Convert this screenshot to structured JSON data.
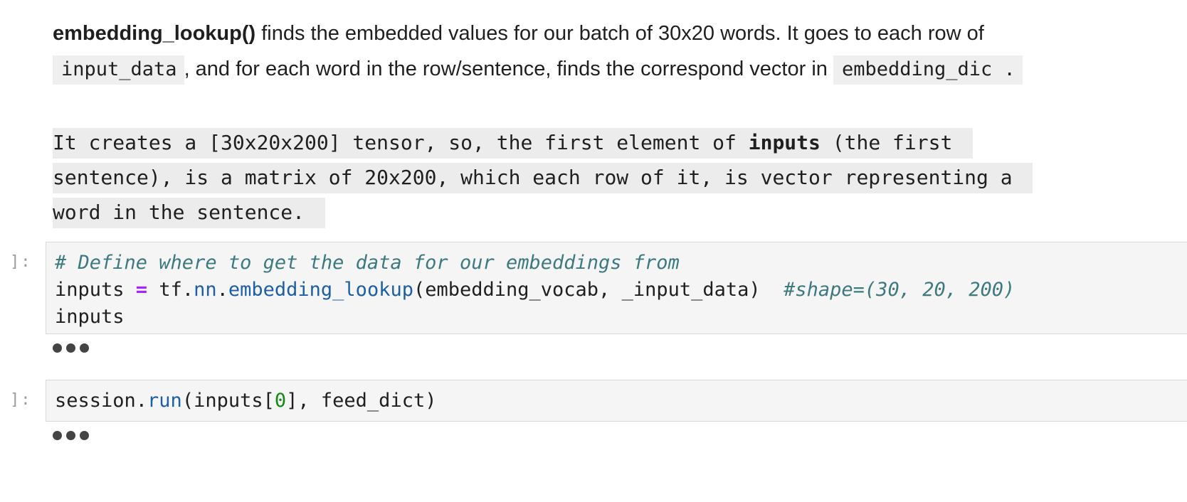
{
  "markdown": {
    "para1": {
      "bold_term": "embedding_lookup()",
      "text_a": " finds the embedded values for our batch of 30x20 words. It goes to each row of",
      "code_input": "input_data",
      "text_b": ", and for each word in the row/sentence, finds the correspond vector in ",
      "code_dic": "embedding_dic ."
    },
    "para2": {
      "line1_a": "It creates a [30x20x200] tensor, so, the first element of ",
      "line1_bold": "inputs",
      "line1_b": " (the first ",
      "line2": "sentence), is a matrix of 20x200, which each row of it, is vector representing a ",
      "line3": "word in the sentence. "
    }
  },
  "cells": [
    {
      "prompt": "]:",
      "comment": "# Define where to get the data for our embeddings from",
      "line2": {
        "var": "inputs ",
        "op": "=",
        "mod": " tf.",
        "attr1": "nn",
        "dot": ".",
        "attr2": "embedding_lookup",
        "args": "(embedding_vocab, _input_data)  ",
        "comment": "#shape=(30, 20, 200)"
      },
      "line3": "inputs"
    },
    {
      "prompt": "]:",
      "line1": {
        "pre": "session.",
        "attr": "run",
        "mid": "(inputs[",
        "num": "0",
        "post": "], feed_dict)"
      }
    }
  ],
  "icons": {
    "collapsed_output": "ellipsis-icon"
  }
}
